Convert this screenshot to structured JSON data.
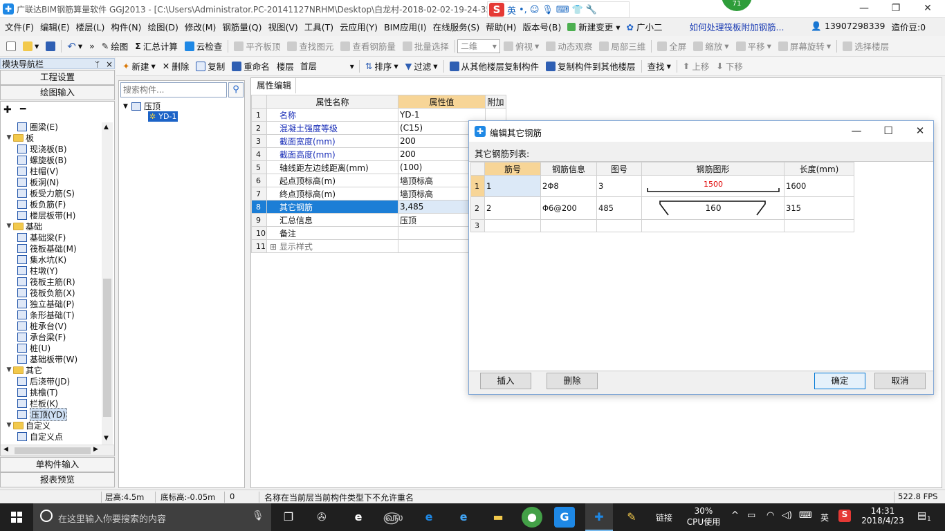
{
  "window": {
    "title": "广联达BIM钢筋算量软件 GGJ2013 - [C:\\Users\\Administrator.PC-20141127NRHM\\Desktop\\白龙村-2018-02-02-19-24-35",
    "notif_count": "71",
    "ime_label": "英"
  },
  "menu": {
    "items": [
      "文件(F)",
      "编辑(E)",
      "楼层(L)",
      "构件(N)",
      "绘图(D)",
      "修改(M)",
      "钢筋量(Q)",
      "视图(V)",
      "工具(T)",
      "云应用(Y)",
      "BIM应用(I)",
      "在线服务(S)",
      "帮助(H)",
      "版本号(B)"
    ],
    "new_change": "新建变更",
    "assistant": "广小二",
    "help_link": "如何处理筏板附加钢筋...",
    "phone": "13907298339",
    "beans": "造价豆:0"
  },
  "toolbar1": {
    "draw": "绘图",
    "sum_calc": "汇总计算",
    "cloud_check": "云检查",
    "align_top": "平齐板顶",
    "find_elem": "查找图元",
    "view_rebar": "查看钢筋量",
    "batch_select": "批量选择",
    "view_mode": "二维",
    "top_view": "俯视",
    "dynamic_view": "动态观察",
    "local_3d": "局部三维",
    "fullscreen": "全屏",
    "zoom": "缩放",
    "pan": "平移",
    "rotate": "屏幕旋转",
    "select_floor": "选择楼层"
  },
  "toolbar2": {
    "new": "新建",
    "delete": "删除",
    "copy": "复制",
    "rename": "重命名",
    "floor_label": "楼层",
    "floor_value": "首层",
    "sort": "排序",
    "filter": "过滤",
    "copy_from": "从其他楼层复制构件",
    "copy_to": "复制构件到其他楼层",
    "find": "查找",
    "move_up": "上移",
    "move_down": "下移"
  },
  "nav": {
    "title": "模块导航栏",
    "pin": "ᛘ",
    "close": "×",
    "project_settings": "工程设置",
    "drawing_input": "绘图输入",
    "single_input": "单构件输入",
    "report_preview": "报表预览",
    "tree": [
      {
        "label": "圈梁(E)",
        "indent": 2,
        "type": "item"
      },
      {
        "label": "板",
        "indent": 1,
        "type": "folder"
      },
      {
        "label": "现浇板(B)",
        "indent": 2,
        "type": "item"
      },
      {
        "label": "螺旋板(B)",
        "indent": 2,
        "type": "item"
      },
      {
        "label": "柱帽(V)",
        "indent": 2,
        "type": "item"
      },
      {
        "label": "板洞(N)",
        "indent": 2,
        "type": "item"
      },
      {
        "label": "板受力筋(S)",
        "indent": 2,
        "type": "item"
      },
      {
        "label": "板负筋(F)",
        "indent": 2,
        "type": "item"
      },
      {
        "label": "楼层板带(H)",
        "indent": 2,
        "type": "item"
      },
      {
        "label": "基础",
        "indent": 1,
        "type": "folder"
      },
      {
        "label": "基础梁(F)",
        "indent": 2,
        "type": "item"
      },
      {
        "label": "筏板基础(M)",
        "indent": 2,
        "type": "item"
      },
      {
        "label": "集水坑(K)",
        "indent": 2,
        "type": "item"
      },
      {
        "label": "柱墩(Y)",
        "indent": 2,
        "type": "item"
      },
      {
        "label": "筏板主筋(R)",
        "indent": 2,
        "type": "item"
      },
      {
        "label": "筏板负筋(X)",
        "indent": 2,
        "type": "item"
      },
      {
        "label": "独立基础(P)",
        "indent": 2,
        "type": "item"
      },
      {
        "label": "条形基础(T)",
        "indent": 2,
        "type": "item"
      },
      {
        "label": "桩承台(V)",
        "indent": 2,
        "type": "item"
      },
      {
        "label": "承台梁(F)",
        "indent": 2,
        "type": "item"
      },
      {
        "label": "桩(U)",
        "indent": 2,
        "type": "item"
      },
      {
        "label": "基础板带(W)",
        "indent": 2,
        "type": "item"
      },
      {
        "label": "其它",
        "indent": 1,
        "type": "folder"
      },
      {
        "label": "后浇带(JD)",
        "indent": 2,
        "type": "item"
      },
      {
        "label": "挑檐(T)",
        "indent": 2,
        "type": "item"
      },
      {
        "label": "栏板(K)",
        "indent": 2,
        "type": "item"
      },
      {
        "label": "压顶(YD)",
        "indent": 2,
        "type": "item",
        "selected": true
      },
      {
        "label": "自定义",
        "indent": 1,
        "type": "folder"
      },
      {
        "label": "自定义点",
        "indent": 2,
        "type": "item"
      }
    ]
  },
  "components": {
    "search_placeholder": "搜索构件...",
    "root": "压顶",
    "child": "YD-1"
  },
  "properties": {
    "tab": "属性编辑",
    "col_name": "属性名称",
    "col_value": "属性值",
    "col_extra": "附加",
    "rows": [
      {
        "n": "1",
        "name": "名称",
        "value": "YD-1",
        "blue": true
      },
      {
        "n": "2",
        "name": "混凝土强度等级",
        "value": "(C15)",
        "blue": true
      },
      {
        "n": "3",
        "name": "截面宽度(mm)",
        "value": "200",
        "blue": true
      },
      {
        "n": "4",
        "name": "截面高度(mm)",
        "value": "200",
        "blue": true
      },
      {
        "n": "5",
        "name": "轴线距左边线距离(mm)",
        "value": "(100)",
        "blue": false
      },
      {
        "n": "6",
        "name": "起点顶标高(m)",
        "value": "墙顶标高",
        "blue": false
      },
      {
        "n": "7",
        "name": "终点顶标高(m)",
        "value": "墙顶标高",
        "blue": false
      },
      {
        "n": "8",
        "name": "其它钢筋",
        "value": "3,485",
        "blue": false,
        "selected": true
      },
      {
        "n": "9",
        "name": "汇总信息",
        "value": "压顶",
        "blue": false
      },
      {
        "n": "10",
        "name": "备注",
        "value": "",
        "blue": false
      },
      {
        "n": "11",
        "name": "显示样式",
        "value": "",
        "blue": false,
        "expand": true
      }
    ]
  },
  "dialog": {
    "title": "编辑其它钢筋",
    "list_label": "其它钢筋列表:",
    "col_no": "筋号",
    "col_info": "钢筋信息",
    "col_fig": "图号",
    "col_shape": "钢筋图形",
    "col_len": "长度(mm)",
    "rows": [
      {
        "rn": "1",
        "no": "1",
        "info": "2Φ8",
        "fig": "3",
        "shape_dim": "1500",
        "len": "1600"
      },
      {
        "rn": "2",
        "no": "2",
        "info": "Φ6@200",
        "fig": "485",
        "shape_dim": "160",
        "len": "315"
      },
      {
        "rn": "3",
        "no": "",
        "info": "",
        "fig": "",
        "shape_dim": "",
        "len": ""
      }
    ],
    "insert": "插入",
    "delete": "删除",
    "ok": "确定",
    "cancel": "取消"
  },
  "status": {
    "floor_height": "层高:4.5m",
    "bottom_elev": "底标高:-0.05m",
    "zero": "0",
    "message": "名称在当前层当前构件类型下不允许重名",
    "fps": "522.8 FPS"
  },
  "taskbar": {
    "search_placeholder": "在这里输入你要搜索的内容",
    "link": "链接",
    "cpu_pct": "30%",
    "cpu_label": "CPU使用",
    "lang": "英",
    "time": "14:31",
    "date": "2018/4/23",
    "notif": "1"
  },
  "colors": {
    "accent": "#1c7ed6",
    "header_highlight": "#f7d597",
    "taskbar": "#1f1f1f",
    "dim_red": "#e00000"
  }
}
